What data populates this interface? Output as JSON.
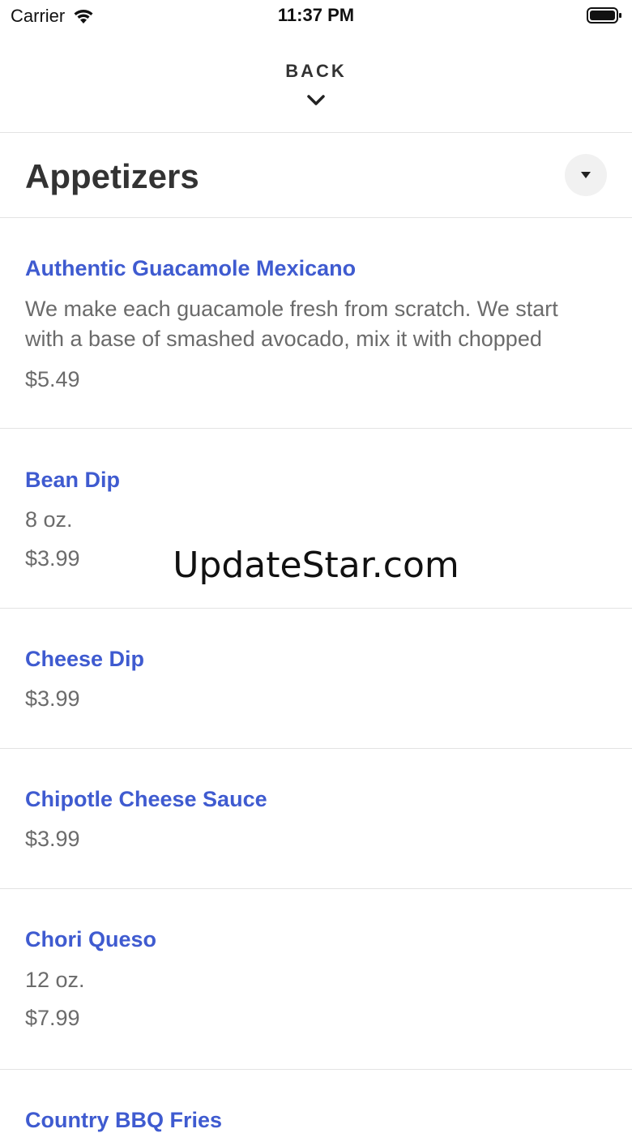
{
  "status_bar": {
    "carrier": "Carrier",
    "time": "11:37 PM"
  },
  "header": {
    "back_label": "BACK"
  },
  "section": {
    "title": "Appetizers"
  },
  "items": [
    {
      "name": "Authentic Guacamole Mexicano",
      "description": "We make each guacamole fresh from scratch. We start with a base of smashed avocado, mix it with chopped",
      "price": "$5.49"
    },
    {
      "name": "Bean Dip",
      "description": "8 oz.",
      "price": "$3.99"
    },
    {
      "name": "Cheese Dip",
      "description": "",
      "price": "$3.99"
    },
    {
      "name": "Chipotle Cheese Sauce",
      "description": "",
      "price": "$3.99"
    },
    {
      "name": "Chori Queso",
      "description": "12 oz.",
      "price": "$7.99"
    },
    {
      "name": "Country BBQ Fries",
      "description": "",
      "price": ""
    }
  ],
  "watermark": "UpdateStar.com",
  "colors": {
    "item_name": "#3f5bd0",
    "secondary_text": "#6b6b6b",
    "divider": "#e3e3e3"
  }
}
